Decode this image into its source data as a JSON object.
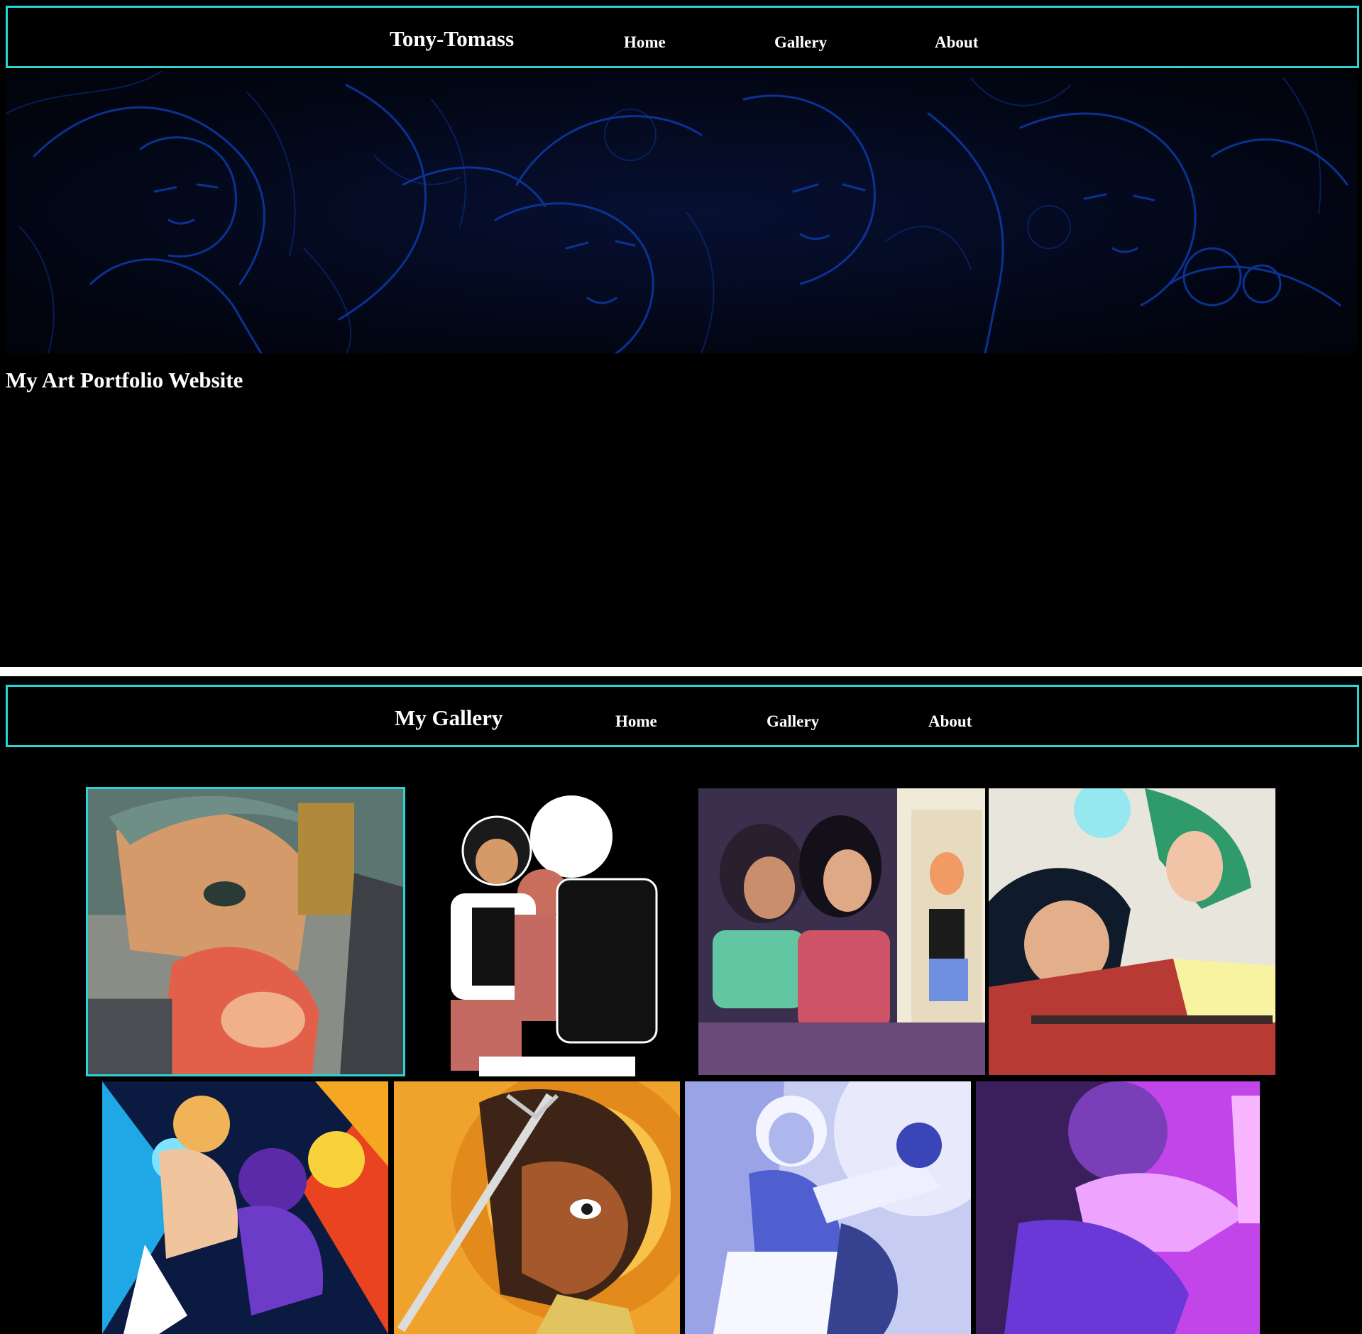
{
  "home": {
    "nav": {
      "brand": "Tony-Tomass",
      "links": [
        "Home",
        "Gallery",
        "About"
      ]
    },
    "heading": "My Art Portfolio Website"
  },
  "gallery": {
    "nav": {
      "brand": "My Gallery",
      "links": [
        "Home",
        "Gallery",
        "About"
      ]
    }
  },
  "colors": {
    "background": "#000000",
    "nav_border": "#2bd4d4",
    "hero_lines": "#0d3aa8",
    "text": "#ffffff"
  }
}
